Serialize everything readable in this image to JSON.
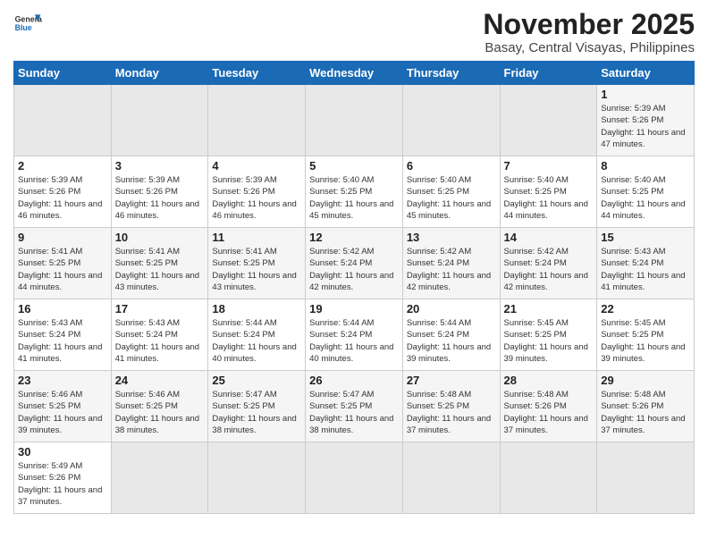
{
  "header": {
    "logo_general": "General",
    "logo_blue": "Blue",
    "month_title": "November 2025",
    "location": "Basay, Central Visayas, Philippines"
  },
  "weekdays": [
    "Sunday",
    "Monday",
    "Tuesday",
    "Wednesday",
    "Thursday",
    "Friday",
    "Saturday"
  ],
  "weeks": [
    [
      {
        "day": "",
        "sunrise": "",
        "sunset": "",
        "daylight": ""
      },
      {
        "day": "",
        "sunrise": "",
        "sunset": "",
        "daylight": ""
      },
      {
        "day": "",
        "sunrise": "",
        "sunset": "",
        "daylight": ""
      },
      {
        "day": "",
        "sunrise": "",
        "sunset": "",
        "daylight": ""
      },
      {
        "day": "",
        "sunrise": "",
        "sunset": "",
        "daylight": ""
      },
      {
        "day": "",
        "sunrise": "",
        "sunset": "",
        "daylight": ""
      },
      {
        "day": "1",
        "sunrise": "Sunrise: 5:39 AM",
        "sunset": "Sunset: 5:26 PM",
        "daylight": "Daylight: 11 hours and 47 minutes."
      }
    ],
    [
      {
        "day": "2",
        "sunrise": "Sunrise: 5:39 AM",
        "sunset": "Sunset: 5:26 PM",
        "daylight": "Daylight: 11 hours and 46 minutes."
      },
      {
        "day": "3",
        "sunrise": "Sunrise: 5:39 AM",
        "sunset": "Sunset: 5:26 PM",
        "daylight": "Daylight: 11 hours and 46 minutes."
      },
      {
        "day": "4",
        "sunrise": "Sunrise: 5:39 AM",
        "sunset": "Sunset: 5:26 PM",
        "daylight": "Daylight: 11 hours and 46 minutes."
      },
      {
        "day": "5",
        "sunrise": "Sunrise: 5:40 AM",
        "sunset": "Sunset: 5:25 PM",
        "daylight": "Daylight: 11 hours and 45 minutes."
      },
      {
        "day": "6",
        "sunrise": "Sunrise: 5:40 AM",
        "sunset": "Sunset: 5:25 PM",
        "daylight": "Daylight: 11 hours and 45 minutes."
      },
      {
        "day": "7",
        "sunrise": "Sunrise: 5:40 AM",
        "sunset": "Sunset: 5:25 PM",
        "daylight": "Daylight: 11 hours and 44 minutes."
      },
      {
        "day": "8",
        "sunrise": "Sunrise: 5:40 AM",
        "sunset": "Sunset: 5:25 PM",
        "daylight": "Daylight: 11 hours and 44 minutes."
      }
    ],
    [
      {
        "day": "9",
        "sunrise": "Sunrise: 5:41 AM",
        "sunset": "Sunset: 5:25 PM",
        "daylight": "Daylight: 11 hours and 44 minutes."
      },
      {
        "day": "10",
        "sunrise": "Sunrise: 5:41 AM",
        "sunset": "Sunset: 5:25 PM",
        "daylight": "Daylight: 11 hours and 43 minutes."
      },
      {
        "day": "11",
        "sunrise": "Sunrise: 5:41 AM",
        "sunset": "Sunset: 5:25 PM",
        "daylight": "Daylight: 11 hours and 43 minutes."
      },
      {
        "day": "12",
        "sunrise": "Sunrise: 5:42 AM",
        "sunset": "Sunset: 5:24 PM",
        "daylight": "Daylight: 11 hours and 42 minutes."
      },
      {
        "day": "13",
        "sunrise": "Sunrise: 5:42 AM",
        "sunset": "Sunset: 5:24 PM",
        "daylight": "Daylight: 11 hours and 42 minutes."
      },
      {
        "day": "14",
        "sunrise": "Sunrise: 5:42 AM",
        "sunset": "Sunset: 5:24 PM",
        "daylight": "Daylight: 11 hours and 42 minutes."
      },
      {
        "day": "15",
        "sunrise": "Sunrise: 5:43 AM",
        "sunset": "Sunset: 5:24 PM",
        "daylight": "Daylight: 11 hours and 41 minutes."
      }
    ],
    [
      {
        "day": "16",
        "sunrise": "Sunrise: 5:43 AM",
        "sunset": "Sunset: 5:24 PM",
        "daylight": "Daylight: 11 hours and 41 minutes."
      },
      {
        "day": "17",
        "sunrise": "Sunrise: 5:43 AM",
        "sunset": "Sunset: 5:24 PM",
        "daylight": "Daylight: 11 hours and 41 minutes."
      },
      {
        "day": "18",
        "sunrise": "Sunrise: 5:44 AM",
        "sunset": "Sunset: 5:24 PM",
        "daylight": "Daylight: 11 hours and 40 minutes."
      },
      {
        "day": "19",
        "sunrise": "Sunrise: 5:44 AM",
        "sunset": "Sunset: 5:24 PM",
        "daylight": "Daylight: 11 hours and 40 minutes."
      },
      {
        "day": "20",
        "sunrise": "Sunrise: 5:44 AM",
        "sunset": "Sunset: 5:24 PM",
        "daylight": "Daylight: 11 hours and 39 minutes."
      },
      {
        "day": "21",
        "sunrise": "Sunrise: 5:45 AM",
        "sunset": "Sunset: 5:25 PM",
        "daylight": "Daylight: 11 hours and 39 minutes."
      },
      {
        "day": "22",
        "sunrise": "Sunrise: 5:45 AM",
        "sunset": "Sunset: 5:25 PM",
        "daylight": "Daylight: 11 hours and 39 minutes."
      }
    ],
    [
      {
        "day": "23",
        "sunrise": "Sunrise: 5:46 AM",
        "sunset": "Sunset: 5:25 PM",
        "daylight": "Daylight: 11 hours and 39 minutes."
      },
      {
        "day": "24",
        "sunrise": "Sunrise: 5:46 AM",
        "sunset": "Sunset: 5:25 PM",
        "daylight": "Daylight: 11 hours and 38 minutes."
      },
      {
        "day": "25",
        "sunrise": "Sunrise: 5:47 AM",
        "sunset": "Sunset: 5:25 PM",
        "daylight": "Daylight: 11 hours and 38 minutes."
      },
      {
        "day": "26",
        "sunrise": "Sunrise: 5:47 AM",
        "sunset": "Sunset: 5:25 PM",
        "daylight": "Daylight: 11 hours and 38 minutes."
      },
      {
        "day": "27",
        "sunrise": "Sunrise: 5:48 AM",
        "sunset": "Sunset: 5:25 PM",
        "daylight": "Daylight: 11 hours and 37 minutes."
      },
      {
        "day": "28",
        "sunrise": "Sunrise: 5:48 AM",
        "sunset": "Sunset: 5:26 PM",
        "daylight": "Daylight: 11 hours and 37 minutes."
      },
      {
        "day": "29",
        "sunrise": "Sunrise: 5:48 AM",
        "sunset": "Sunset: 5:26 PM",
        "daylight": "Daylight: 11 hours and 37 minutes."
      }
    ],
    [
      {
        "day": "30",
        "sunrise": "Sunrise: 5:49 AM",
        "sunset": "Sunset: 5:26 PM",
        "daylight": "Daylight: 11 hours and 37 minutes."
      },
      {
        "day": "",
        "sunrise": "",
        "sunset": "",
        "daylight": ""
      },
      {
        "day": "",
        "sunrise": "",
        "sunset": "",
        "daylight": ""
      },
      {
        "day": "",
        "sunrise": "",
        "sunset": "",
        "daylight": ""
      },
      {
        "day": "",
        "sunrise": "",
        "sunset": "",
        "daylight": ""
      },
      {
        "day": "",
        "sunrise": "",
        "sunset": "",
        "daylight": ""
      },
      {
        "day": "",
        "sunrise": "",
        "sunset": "",
        "daylight": ""
      }
    ]
  ]
}
